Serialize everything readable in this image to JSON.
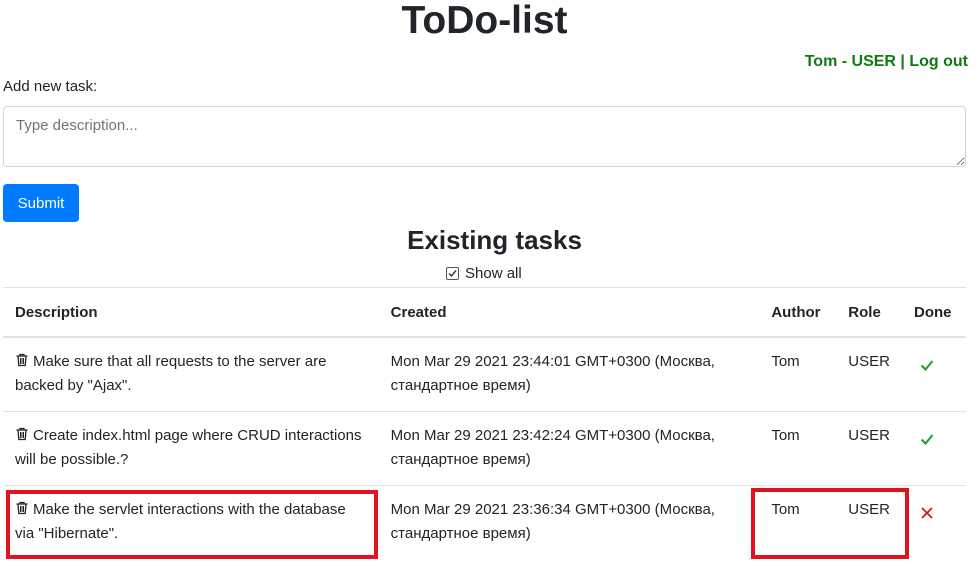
{
  "header": {
    "title": "ToDo-list",
    "user_name": "Tom",
    "user_role": "USER",
    "separator_dash": " - ",
    "separator_bar": " | ",
    "logout_label": "Log out"
  },
  "form": {
    "add_label": "Add new task:",
    "description_placeholder": "Type description...",
    "submit_label": "Submit"
  },
  "tasks_section": {
    "title": "Existing tasks",
    "show_all_label": "Show all",
    "show_all_checked": true,
    "columns": [
      "Description",
      "Created",
      "Author",
      "Role",
      "Done"
    ],
    "rows": [
      {
        "description": "Make sure that all requests to the server are backed by \"Ajax\".",
        "created": "Mon Mar 29 2021 23:44:01 GMT+0300 (Москва, стандартное время)",
        "author": "Tom",
        "role": "USER",
        "done": true
      },
      {
        "description": "Create index.html page where CRUD interactions will be possible.?",
        "created": "Mon Mar 29 2021 23:42:24 GMT+0300 (Москва, стандартное время)",
        "author": "Tom",
        "role": "USER",
        "done": true
      },
      {
        "description": "Make the servlet interactions with the database via \"Hibernate\".",
        "created": "Mon Mar 29 2021 23:36:34 GMT+0300 (Москва, стандартное время)",
        "author": "Tom",
        "role": "USER",
        "done": false
      }
    ]
  },
  "colors": {
    "accent": "#007bff",
    "user_text": "#0f7b0f",
    "done_true": "#18a02c",
    "done_false": "#e0121e",
    "highlight": "#e0121e"
  },
  "icons": {
    "delete": "trash-icon",
    "done": "check-icon",
    "not_done": "cross-icon",
    "show_all": "checkbox-checked-icon"
  }
}
